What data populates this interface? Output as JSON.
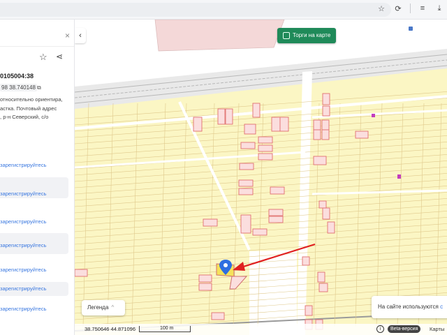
{
  "browser": {
    "icons": [
      "star-icon",
      "extensions-icon",
      "reading-list-icon",
      "download-icon"
    ],
    "glyphs": {
      "star": "☆",
      "extensions": "⟳",
      "reading_list": "≡",
      "download": "⤓"
    }
  },
  "panel": {
    "close_glyph": "×",
    "star_glyph": "☆",
    "share_glyph": "⋖",
    "cadastral_number": "0105004:38",
    "coordinates": "98 38.740148",
    "copy_glyph": "⧉",
    "address_lines": [
      "относительно ориентира,",
      "астка. Почтовый адрес",
      ", р-н Северский, с/о"
    ],
    "register_links": [
      "зарегистрируйтесь",
      "зарегистрируйтесь",
      "зарегистрируйтесь",
      "зарегистрируйтесь",
      "зарегистрируйтесь",
      "зарегистрируйтесь",
      "зарегистрируйтесь"
    ]
  },
  "map": {
    "torgi_button": "Торги на карте",
    "collapse_glyph": "‹",
    "legend_label": "Легенда",
    "legend_chevron": "^",
    "cookie_text": "На сайте используются",
    "cookie_link": "c",
    "coord_readout": "38.750646  44.871096",
    "scale_label": "100 m",
    "info_glyph": "i",
    "beta_label": "Beta-версия",
    "maps_label": "Карты",
    "colors": {
      "parcel_fill": "#fbf6c4",
      "parcel_line": "#e0c98c",
      "highlight_parcel": "#e07070",
      "arrow": "#e02020",
      "marker": "#2f6ee0",
      "selected_parcel": "#f5e25a",
      "accent_green": "#1f8a59"
    }
  }
}
